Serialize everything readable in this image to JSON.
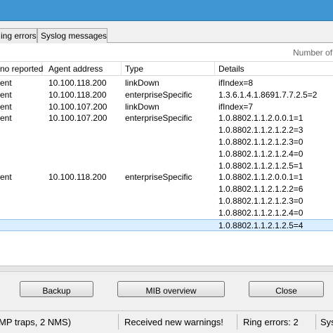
{
  "tabs": [
    {
      "label": "ing errors"
    },
    {
      "label": "Syslog messages"
    }
  ],
  "info": {
    "count_label": "Number of"
  },
  "table": {
    "headers": [
      "no reported",
      "Agent address",
      "Type",
      "Details"
    ],
    "rows": [
      [
        "ent",
        "10.100.118.200",
        "linkDown",
        "ifIndex=8"
      ],
      [
        "ent",
        "10.100.118.200",
        "enterpriseSpecific",
        "1.3.6.1.4.1.8691.7.7.2.5=2"
      ],
      [
        "ent",
        "10.100.107.200",
        "linkDown",
        "ifIndex=7"
      ],
      [
        "ent",
        "10.100.107.200",
        "enterpriseSpecific",
        "1.0.8802.1.1.2.0.0.1=1"
      ],
      [
        "",
        "",
        "",
        "1.0.8802.1.1.2.1.2.2=3"
      ],
      [
        "",
        "",
        "",
        "1.0.8802.1.1.2.1.2.3=0"
      ],
      [
        "",
        "",
        "",
        "1.0.8802.1.1.2.1.2.4=0"
      ],
      [
        "",
        "",
        "",
        "1.0.8802.1.1.2.1.2.5=1"
      ],
      [
        "ent",
        "10.100.118.200",
        "enterpriseSpecific",
        "1.0.8802.1.1.2.0.0.1=1"
      ],
      [
        "",
        "",
        "",
        "1.0.8802.1.1.2.1.2.2=6"
      ],
      [
        "",
        "",
        "",
        "1.0.8802.1.1.2.1.2.3=0"
      ],
      [
        "",
        "",
        "",
        "1.0.8802.1.1.2.1.2.4=0"
      ],
      [
        "",
        "",
        "",
        "1.0.8802.1.1.2.1.2.5=4"
      ]
    ],
    "selected_row": 12
  },
  "buttons": {
    "backup": "Backup",
    "mib": "MIB overview",
    "close": "Close"
  },
  "status": {
    "left": "MP traps, 2 NMS)",
    "middle": "Received new warnings!",
    "ring": "Ring errors: 2",
    "sys": "Sys"
  },
  "colors": {
    "titlebar": "#3f95d2",
    "selection": "#dbeeff"
  }
}
